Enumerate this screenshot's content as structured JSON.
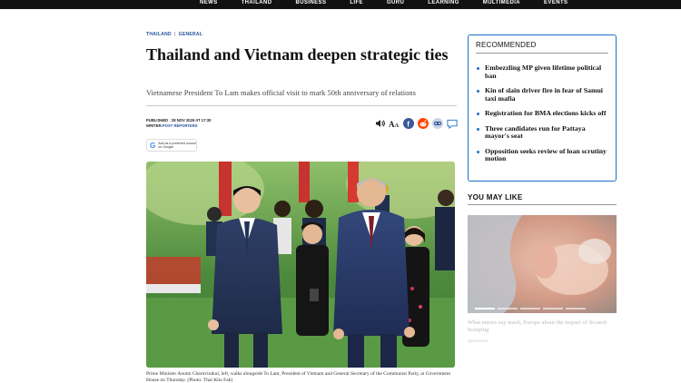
{
  "nav": {
    "items": [
      "NEWS",
      "THAILAND",
      "BUSINESS",
      "LIFE",
      "GURU",
      "LEARNING",
      "MULTIMEDIA",
      "EVENTS"
    ]
  },
  "breadcrumb": {
    "section": "THAILAND",
    "subsection": "GENERAL"
  },
  "article": {
    "title": "Thailand and Vietnam deepen strategic ties",
    "subtitle": "Vietnamese President To Lam makes official visit to mark 50th anniversary of relations",
    "published_label": "PUBLISHED : 28 NOV 2026 AT 17:30",
    "writer_label": "WRITER:",
    "writer": "POST REPORTERS",
    "google_badge": "Add as a preferred source on Google",
    "caption": "Prime Minister Anutin Charnvirakul, left, walks alongside To Lam, President of Vietnam and General Secretary of the Communist Party, at Government House on Thursday. (Photo: Thai Khu Fah)"
  },
  "share_icons": [
    "speaker-icon",
    "text-size-icon",
    "facebook-icon",
    "reddit-icon",
    "link-icon",
    "comment-icon"
  ],
  "recommended": {
    "title": "RECOMMENDED",
    "items": [
      "Embezzling MP given lifetime political ban",
      "Kin of slain driver fire in fear of Samui taxi mafia",
      "Registration for BMA elections kicks off",
      "Three candidates run for Pattaya mayor's seat",
      "Opposition seeks review of loan scrutiny motion"
    ]
  },
  "you_may_like": {
    "title": "YOU MAY LIKE",
    "caption": "What nurses say teach, Europe about the impact of Scratch Scraping",
    "source": "Sponsored"
  },
  "colors": {
    "accent": "#1f6fc8",
    "nav_bg": "#111111"
  }
}
